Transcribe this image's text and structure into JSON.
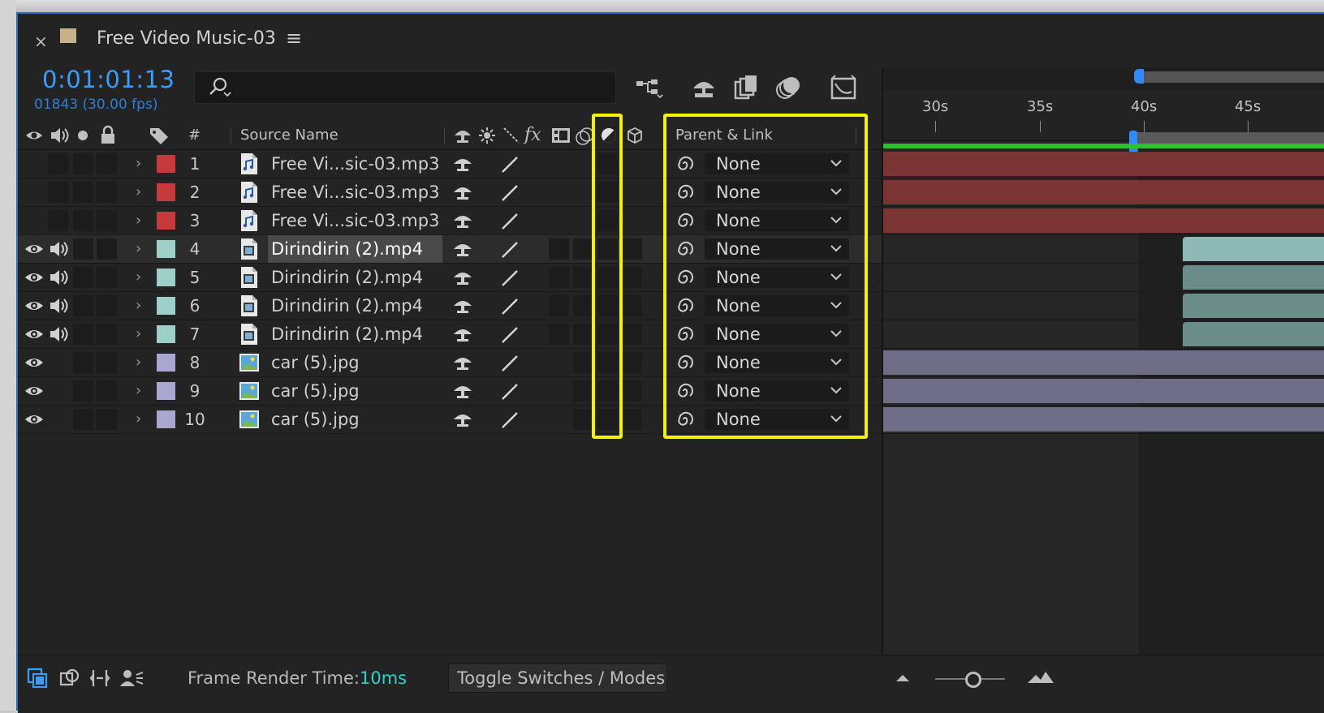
{
  "tab": {
    "close": "×",
    "title": "Free Video Music-03",
    "menu": "≡",
    "swatch_color": "#c8b08a"
  },
  "time": {
    "timecode": "0:01:01:13",
    "frames": "01843 (30.00 fps)"
  },
  "search": {
    "placeholder": "",
    "icon": "search-icon"
  },
  "toolbar": {
    "icons": [
      "composition-flowchart-icon",
      "shy-layers-icon",
      "frame-blending-icon",
      "motion-blur-icon",
      "graph-editor-icon"
    ]
  },
  "columns": {
    "hash": "#",
    "source_name": "Source Name",
    "parent_link": "Parent & Link",
    "fx": "fx"
  },
  "layers": [
    {
      "num": "1",
      "name": "Free Vi...sic-03.mp3",
      "color": "#c53a3a",
      "type": "audio",
      "eye": false,
      "audio": false,
      "parent": "None"
    },
    {
      "num": "2",
      "name": "Free Vi...sic-03.mp3",
      "color": "#c53a3a",
      "type": "audio",
      "eye": false,
      "audio": false,
      "parent": "None"
    },
    {
      "num": "3",
      "name": "Free Vi...sic-03.mp3",
      "color": "#c53a3a",
      "type": "audio",
      "eye": false,
      "audio": false,
      "parent": "None"
    },
    {
      "num": "4",
      "name": "Dirindirin (2).mp4",
      "color": "#9fcfc9",
      "type": "video",
      "eye": true,
      "audio": true,
      "parent": "None",
      "selected": true
    },
    {
      "num": "5",
      "name": "Dirindirin (2).mp4",
      "color": "#9fcfc9",
      "type": "video",
      "eye": true,
      "audio": true,
      "parent": "None"
    },
    {
      "num": "6",
      "name": "Dirindirin (2).mp4",
      "color": "#9fcfc9",
      "type": "video",
      "eye": true,
      "audio": true,
      "parent": "None"
    },
    {
      "num": "7",
      "name": "Dirindirin (2).mp4",
      "color": "#9fcfc9",
      "type": "video",
      "eye": true,
      "audio": true,
      "parent": "None"
    },
    {
      "num": "8",
      "name": "car (5).jpg",
      "color": "#a9a7cf",
      "type": "image",
      "eye": true,
      "audio": false,
      "parent": "None"
    },
    {
      "num": "9",
      "name": "car (5).jpg",
      "color": "#a9a7cf",
      "type": "image",
      "eye": true,
      "audio": false,
      "parent": "None"
    },
    {
      "num": "10",
      "name": "car (5).jpg",
      "color": "#a9a7cf",
      "type": "image",
      "eye": true,
      "audio": false,
      "parent": "None"
    }
  ],
  "ruler": {
    "ticks": [
      "30s",
      "35s",
      "40s",
      "45s"
    ]
  },
  "bar_colors": {
    "audio": "#7a3434",
    "video": "#6b8d8a",
    "image": "#6f6e86"
  },
  "bottom": {
    "render_label": "Frame Render Time:",
    "render_value": "10ms",
    "toggle": "Toggle Switches / Modes"
  },
  "highlight_color": "#f4f000"
}
